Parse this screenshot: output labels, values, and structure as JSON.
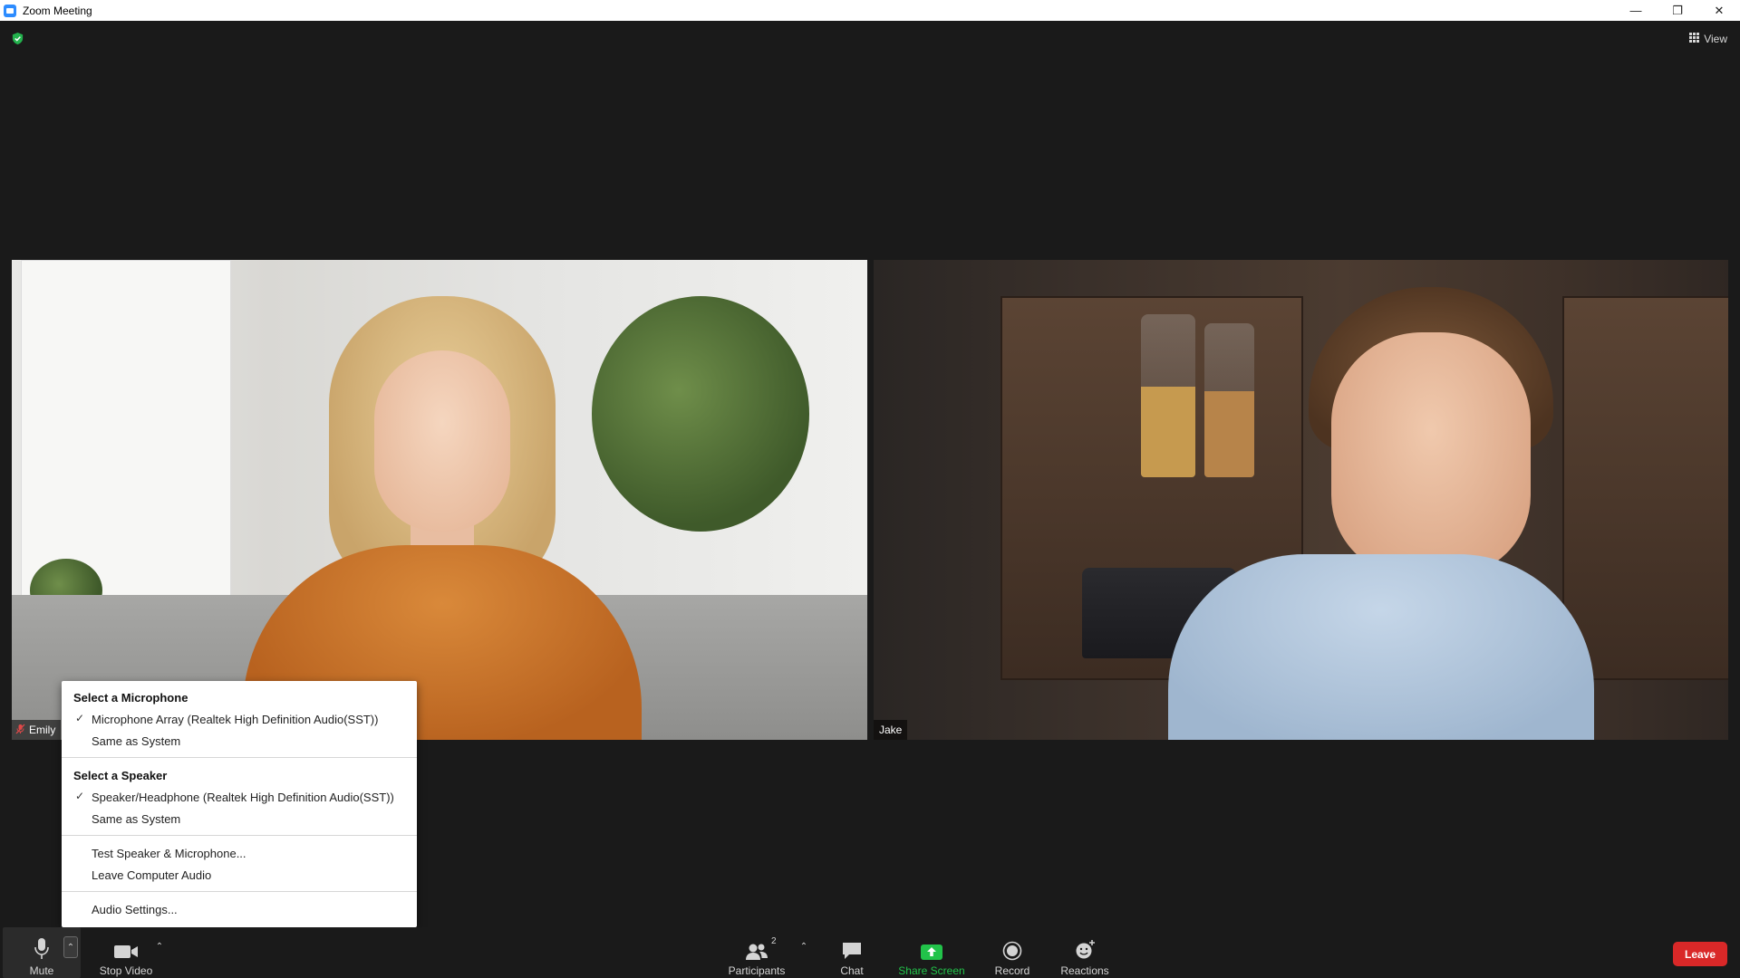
{
  "window": {
    "title": "Zoom Meeting",
    "minimize_glyph": "—",
    "restore_glyph": "❐",
    "close_glyph": "✕"
  },
  "topbar": {
    "view_label": "View",
    "security_icon": "shield-check-icon"
  },
  "participants": [
    {
      "name": "Emily",
      "muted": true
    },
    {
      "name": "Jake",
      "muted": false
    }
  ],
  "audio_menu": {
    "microphone_header": "Select a Microphone",
    "microphone_items": [
      {
        "label": "Microphone Array (Realtek High Definition Audio(SST))",
        "checked": true
      },
      {
        "label": "Same as System",
        "checked": false
      }
    ],
    "speaker_header": "Select a Speaker",
    "speaker_items": [
      {
        "label": "Speaker/Headphone (Realtek High Definition Audio(SST))",
        "checked": true
      },
      {
        "label": "Same as System",
        "checked": false
      }
    ],
    "test_label": "Test Speaker & Microphone...",
    "leave_audio_label": "Leave Computer Audio",
    "settings_label": "Audio Settings..."
  },
  "toolbar": {
    "mute_label": "Mute",
    "stop_video_label": "Stop Video",
    "participants_label": "Participants",
    "participants_count": "2",
    "chat_label": "Chat",
    "share_screen_label": "Share Screen",
    "record_label": "Record",
    "reactions_label": "Reactions",
    "leave_label": "Leave"
  },
  "colors": {
    "background": "#1a1a1a",
    "share_green": "#22c34a",
    "leave_red": "#d92828",
    "shield_green": "#23b14d",
    "brand_blue": "#2d8cff"
  }
}
